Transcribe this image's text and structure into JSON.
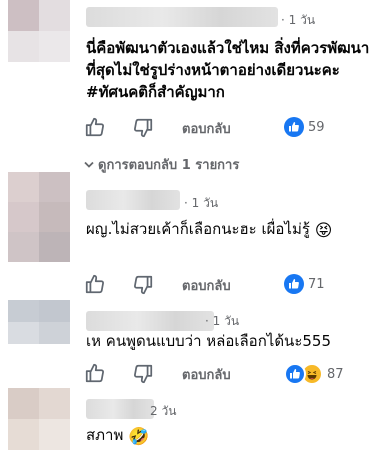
{
  "comments": [
    {
      "time": "· 1 วัน",
      "text": "นี่คือพัฒนาตัวเองแล้วใช่ไหม สิ่งที่ควรพัฒนาที่สุดไม่ใช่รูปร่างหน้าตาอย่างเดียวนะคะ #ทัศนคติก็สำคัญมาก",
      "reply": "ตอบกลับ",
      "count": "59",
      "reactions": [
        "like"
      ]
    },
    {
      "time": "· 1 วัน",
      "text": "ผญ.ไม่สวยเค้าก็เลือกนะฮะ เผื่อไม่รู้",
      "emoji": "😝",
      "reply": "ตอบกลับ",
      "count": "71",
      "reactions": [
        "like"
      ]
    },
    {
      "time": "· 1 วัน",
      "text": "เห คนพูดนแบบว่า หล่อเลือกได้นะ555",
      "reply": "ตอบกลับ",
      "count": "87",
      "reactions": [
        "like",
        "haha"
      ]
    },
    {
      "time": "2 วัน",
      "text": "สภาพ",
      "emoji": "🤣"
    }
  ],
  "thread_toggle": "ดูการตอบกลับ 1 รายการ",
  "colors": {
    "accent": "#1877f2",
    "muted": "#65676b"
  },
  "icons": [
    "like-icon",
    "dislike-icon",
    "chevron-down-icon",
    "like-reaction-icon",
    "haha-reaction-icon"
  ]
}
